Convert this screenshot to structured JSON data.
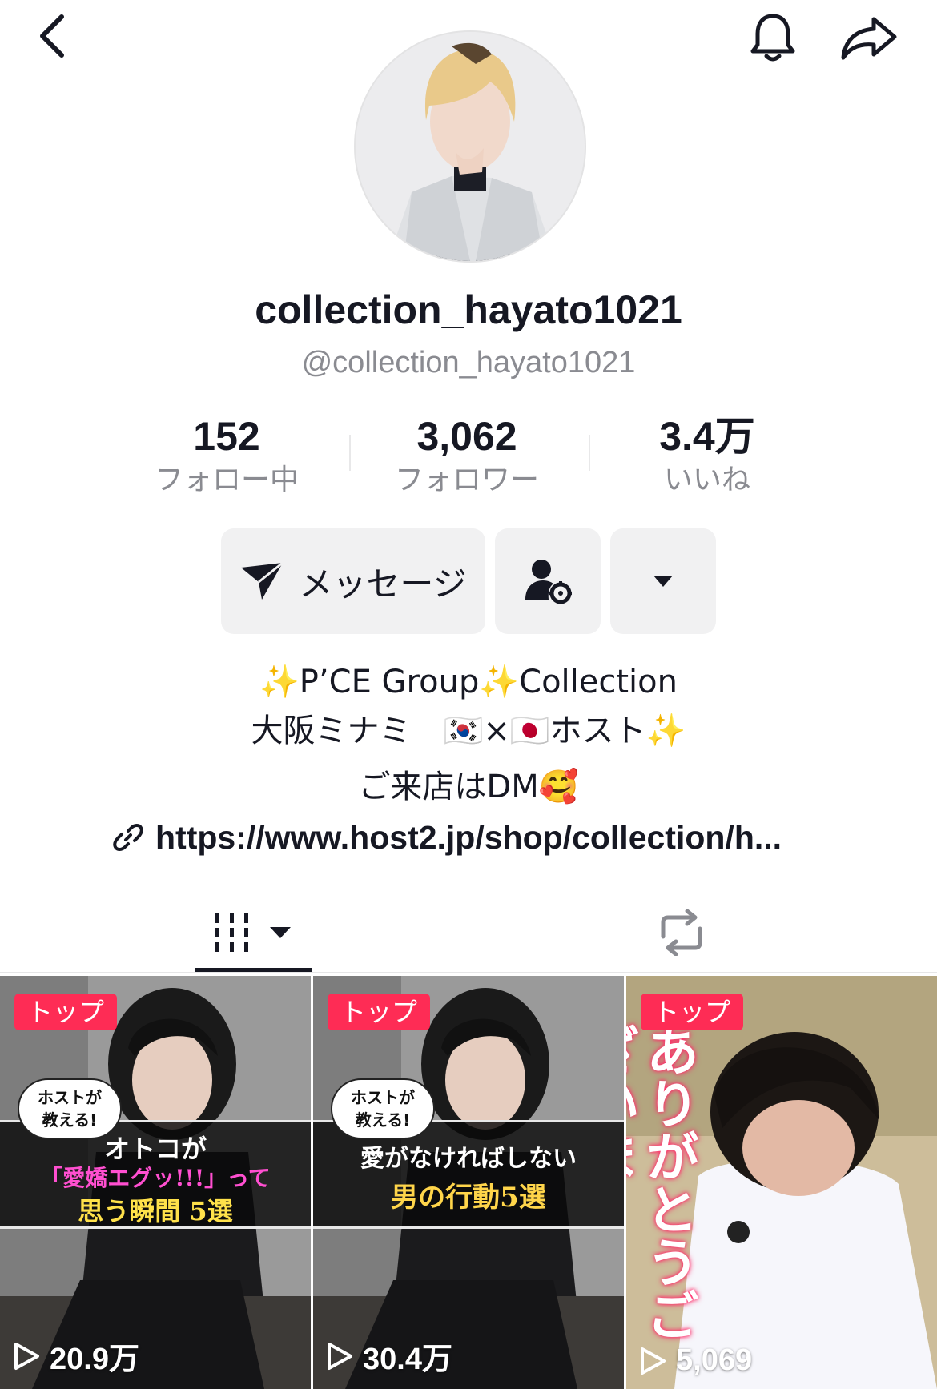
{
  "profile": {
    "display_name": "collection_hayato1021",
    "handle": "@collection_hayato1021"
  },
  "stats": {
    "following_value": "152",
    "following_label": "フォロー中",
    "followers_value": "3,062",
    "followers_label": "フォロワー",
    "likes_value": "3.4万",
    "likes_label": "いいね"
  },
  "actions": {
    "message_label": "メッセージ"
  },
  "bio": {
    "line1": "✨P’CE Group✨Collection",
    "line2": "大阪ミナミ　🇰🇷×🇯🇵ホスト✨",
    "line3": "ご来店はDM🥰",
    "link": "https://www.host2.jp/shop/collection/h..."
  },
  "videos": [
    {
      "badge": "トップ",
      "views": "20.9万",
      "bubble": "ホストが\n教える!",
      "caption_line1": "オトコが",
      "caption_line2": "「愛嬌エグッ!!!」って",
      "caption_line3": "思う瞬間 5選"
    },
    {
      "badge": "トップ",
      "views": "30.4万",
      "bubble": "ホストが\n教える!",
      "caption_line1": "愛がなければしない",
      "caption_line2": "男の行動5選"
    },
    {
      "badge": "トップ",
      "views": "5,069",
      "overlay": "ありがとうございま"
    }
  ],
  "colors": {
    "badge": "#fe2c55",
    "text_primary": "#161823",
    "text_secondary": "#8a8b91",
    "button_bg": "#f1f1f2"
  }
}
